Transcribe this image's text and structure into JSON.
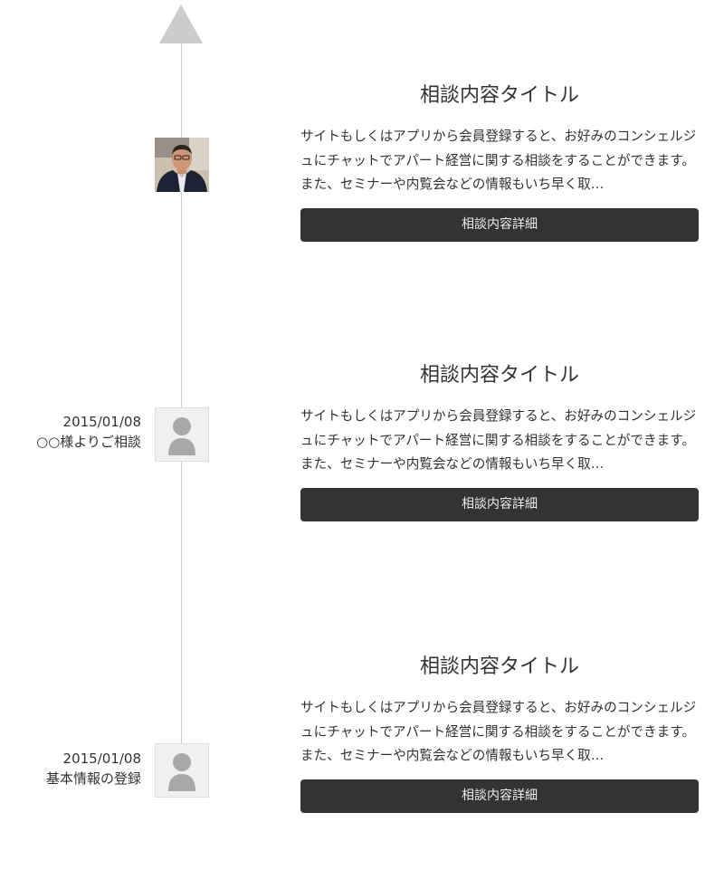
{
  "timeline": {
    "entries": [
      {
        "date": "",
        "event": "",
        "avatar": "person-photo",
        "title": "相談内容タイトル",
        "body": "サイトもしくはアプリから会員登録すると、お好みのコンシェルジュにチャットでアパート経営に関する相談をすることができます。また、セミナーや内覧会などの情報もいち早く取…",
        "button_label": "相談内容詳細"
      },
      {
        "date": "2015/01/08",
        "event": "○○様よりご相談",
        "avatar": "user-placeholder",
        "title": "相談内容タイトル",
        "body": "サイトもしくはアプリから会員登録すると、お好みのコンシェルジュにチャットでアパート経営に関する相談をすることができます。また、セミナーや内覧会などの情報もいち早く取…",
        "button_label": "相談内容詳細"
      },
      {
        "date": "2015/01/08",
        "event": "基本情報の登録",
        "avatar": "user-placeholder",
        "title": "相談内容タイトル",
        "body": "サイトもしくはアプリから会員登録すると、お好みのコンシェルジュにチャットでアパート経営に関する相談をすることができます。また、セミナーや内覧会などの情報もいち早く取…",
        "button_label": "相談内容詳細"
      }
    ]
  },
  "colors": {
    "timeline": "#cccccc",
    "button_bg": "#333333",
    "button_text": "#eeeeee",
    "text": "#333333"
  },
  "icons": {
    "arrow": "up-arrow-icon",
    "placeholder": "user-placeholder-icon"
  }
}
